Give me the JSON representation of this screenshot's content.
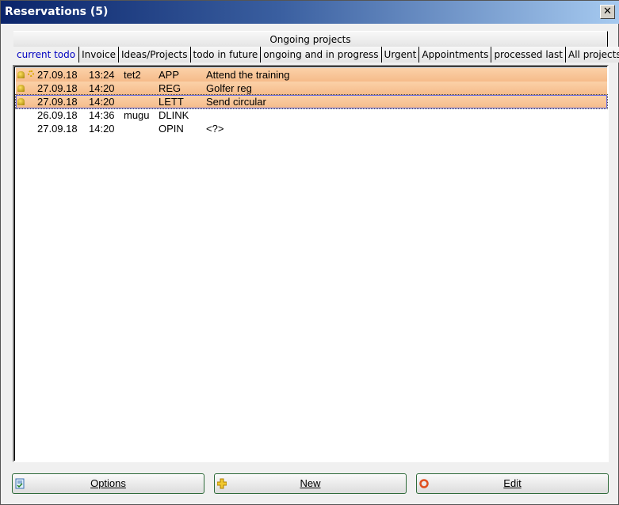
{
  "window": {
    "title": "Reservations (5)",
    "close": "✕"
  },
  "tabs_row1": "Ongoing projects",
  "tabs": [
    "current todo",
    "Invoice",
    "Ideas/Projects",
    "todo in future",
    "ongoing and in progress",
    "Urgent",
    "Appointments",
    "processed last",
    "All projects"
  ],
  "rows": [
    {
      "date": "27.09.18",
      "time": "13:24",
      "user": "tet2",
      "code": "APP",
      "desc": "Attend the training",
      "bell": true,
      "sun": true,
      "highlight": true,
      "selected": false
    },
    {
      "date": "27.09.18",
      "time": "14:20",
      "user": "",
      "code": "REG",
      "desc": "Golfer reg",
      "bell": true,
      "sun": false,
      "highlight": true,
      "selected": false
    },
    {
      "date": "27.09.18",
      "time": "14:20",
      "user": "",
      "code": "LETT",
      "desc": "Send circular",
      "bell": true,
      "sun": false,
      "highlight": true,
      "selected": true
    },
    {
      "date": "26.09.18",
      "time": "14:36",
      "user": "mugu",
      "code": "DLINK",
      "desc": "",
      "bell": false,
      "sun": false,
      "highlight": false,
      "selected": false
    },
    {
      "date": "27.09.18",
      "time": "14:20",
      "user": "",
      "code": "OPIN",
      "desc": "<?>",
      "bell": false,
      "sun": false,
      "highlight": false,
      "selected": false
    }
  ],
  "buttons": {
    "options": "Options",
    "new": "New",
    "edit": "Edit"
  }
}
